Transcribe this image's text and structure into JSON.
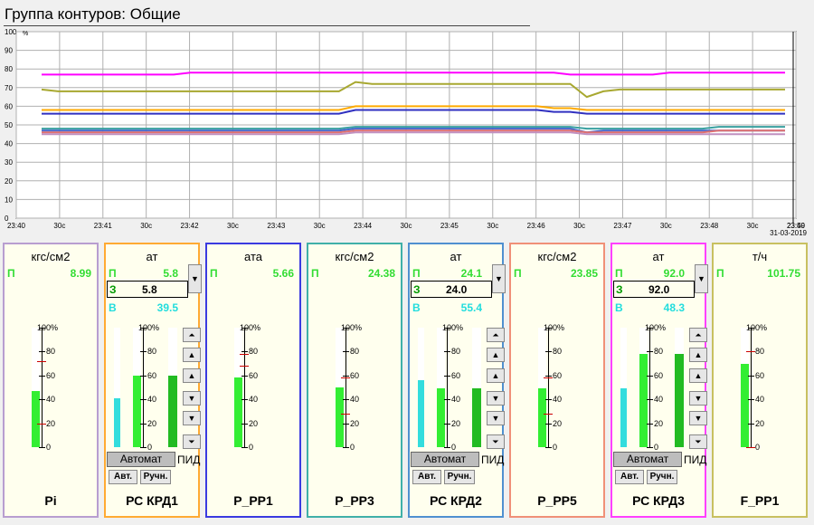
{
  "window": {
    "title": "Группа контуров: Общие"
  },
  "trend": {
    "y_ticks": [
      "100",
      "90",
      "80",
      "70",
      "60",
      "50",
      "40",
      "30",
      "20",
      "10",
      "0"
    ],
    "y_unit": "%",
    "x_ticks": [
      "23:40",
      "30с",
      "23:41",
      "30с",
      "23:42",
      "30с",
      "23:43",
      "30с",
      "23:44",
      "30с",
      "23:45",
      "30с",
      "23:46",
      "30с",
      "23:47",
      "30с",
      "23:48",
      "30с",
      "23:49",
      "23:50"
    ],
    "date": "31-03-2019",
    "series": [
      {
        "color": "#ff00ff",
        "values": [
          77,
          77,
          77,
          77,
          77,
          77,
          77,
          77,
          77,
          78,
          78,
          78,
          78,
          78,
          78,
          78,
          78,
          78,
          78,
          78,
          78,
          78,
          78,
          78,
          78,
          78,
          78,
          78,
          78,
          78,
          78,
          78,
          77,
          77,
          77,
          77,
          77,
          77,
          78,
          78,
          78,
          78,
          78,
          78,
          78,
          78
        ]
      },
      {
        "color": "#a8a830",
        "values": [
          69,
          68,
          68,
          68,
          68,
          68,
          68,
          68,
          68,
          68,
          68,
          68,
          68,
          68,
          68,
          68,
          68,
          68,
          68,
          73,
          72,
          72,
          72,
          72,
          72,
          72,
          72,
          72,
          72,
          72,
          72,
          72,
          72,
          65,
          68,
          69,
          69,
          69,
          69,
          69,
          69,
          69,
          69,
          69,
          69,
          69
        ]
      },
      {
        "color": "#ffaa00",
        "values": [
          58,
          58,
          58,
          58,
          58,
          58,
          58,
          58,
          58,
          58,
          58,
          58,
          58,
          58,
          58,
          58,
          58,
          58,
          58,
          60,
          60,
          60,
          60,
          60,
          60,
          60,
          60,
          60,
          60,
          60,
          60,
          59,
          59,
          58,
          58,
          58,
          58,
          58,
          58,
          58,
          58,
          58,
          58,
          58,
          58,
          58
        ]
      },
      {
        "color": "#3030c0",
        "values": [
          56,
          56,
          56,
          56,
          56,
          56,
          56,
          56,
          56,
          56,
          56,
          56,
          56,
          56,
          56,
          56,
          56,
          56,
          56,
          58,
          58,
          58,
          58,
          58,
          58,
          58,
          58,
          58,
          58,
          58,
          58,
          57,
          57,
          56,
          56,
          56,
          56,
          56,
          56,
          56,
          56,
          56,
          56,
          56,
          56,
          56
        ]
      },
      {
        "color": "#3aa0a0",
        "values": [
          48,
          48,
          48,
          48,
          48,
          48,
          48,
          48,
          48,
          48,
          48,
          48,
          48,
          48,
          48,
          48,
          48,
          48,
          48,
          49,
          49,
          49,
          49,
          49,
          49,
          49,
          49,
          49,
          49,
          49,
          49,
          49,
          49,
          48,
          48,
          48,
          48,
          48,
          48,
          48,
          48,
          49,
          49,
          49,
          49,
          49
        ]
      },
      {
        "color": "#4466cc",
        "values": [
          47,
          47,
          47,
          47,
          47,
          47,
          47,
          47,
          47,
          47,
          47,
          47,
          47,
          47,
          47,
          47,
          47,
          47,
          47,
          48,
          48,
          48,
          48,
          48,
          48,
          48,
          48,
          48,
          48,
          48,
          48,
          48,
          48,
          46,
          47,
          47,
          47,
          47,
          47,
          47,
          47,
          47,
          47,
          47,
          47,
          47
        ]
      },
      {
        "color": "#e07070",
        "values": [
          46,
          46,
          46,
          46,
          46,
          46,
          46,
          46,
          46,
          46,
          46,
          46,
          46,
          46,
          46,
          46,
          46,
          46,
          46,
          47,
          47,
          47,
          47,
          47,
          47,
          47,
          47,
          47,
          47,
          47,
          47,
          47,
          47,
          46,
          46,
          46,
          46,
          46,
          46,
          46,
          46,
          47,
          47,
          47,
          47,
          47
        ]
      },
      {
        "color": "#c090c0",
        "values": [
          45,
          45,
          45,
          45,
          45,
          45,
          45,
          45,
          45,
          45,
          45,
          45,
          45,
          45,
          45,
          45,
          45,
          45,
          45,
          46,
          46,
          46,
          46,
          46,
          46,
          46,
          46,
          46,
          46,
          46,
          46,
          46,
          46,
          45,
          45,
          45,
          45,
          45,
          45,
          45,
          45,
          45,
          45,
          45,
          45,
          45
        ]
      }
    ]
  },
  "scale_ticks": [
    "100%",
    "80",
    "60",
    "40",
    "20",
    "0"
  ],
  "buttons": {
    "auto_mode": "Автомат",
    "pid": "ПИД",
    "auto": "Авт.",
    "manual": "Ручн."
  },
  "row_labels": {
    "p": "П",
    "z": "З",
    "b": "В"
  },
  "panels": [
    {
      "name": "Pi",
      "unit": "кгс/см2",
      "border": "#b89ed0",
      "type": "simple",
      "p": "8.99",
      "pv": 47,
      "sp_mark": 72,
      "lo_mark": 20
    },
    {
      "name": "РС КРД1",
      "unit": "ат",
      "border": "#ffaa33",
      "type": "controller",
      "p": "5.8",
      "z": "5.8",
      "b": "39.5",
      "pv": 41,
      "sp": 60,
      "out": 60,
      "zshort": true
    },
    {
      "name": "P_PP1",
      "unit": "ата",
      "border": "#3a3ae0",
      "type": "simple",
      "p": "5.66",
      "pv": 58,
      "sp_mark": 78,
      "lo_mark": 68
    },
    {
      "name": "P_PP3",
      "unit": "кгс/см2",
      "border": "#40b0a8",
      "type": "simple",
      "p": "24.38",
      "pv": 50,
      "sp_mark": 58,
      "lo_mark": 28
    },
    {
      "name": "РС КРД2",
      "unit": "ат",
      "border": "#5090d0",
      "type": "controller",
      "p": "24.1",
      "z": "24.0",
      "b": "55.4",
      "pv": 56,
      "sp": 49,
      "out": 49,
      "zshort": true
    },
    {
      "name": "P_PP5",
      "unit": "кгс/см2",
      "border": "#f09078",
      "type": "simple",
      "p": "23.85",
      "pv": 49,
      "sp_mark": 58,
      "lo_mark": 28
    },
    {
      "name": "РС КРД3",
      "unit": "ат",
      "border": "#ff40ff",
      "type": "controller",
      "p": "92.0",
      "z": "92.0",
      "b": "48.3",
      "pv": 49,
      "sp": 78,
      "out": 78,
      "zshort": true
    },
    {
      "name": "F_PP1",
      "unit": "т/ч",
      "border": "#c8c060",
      "type": "simple",
      "p": "101.75",
      "pv": 70,
      "sp_mark": 80,
      "lo_mark": 0
    }
  ]
}
